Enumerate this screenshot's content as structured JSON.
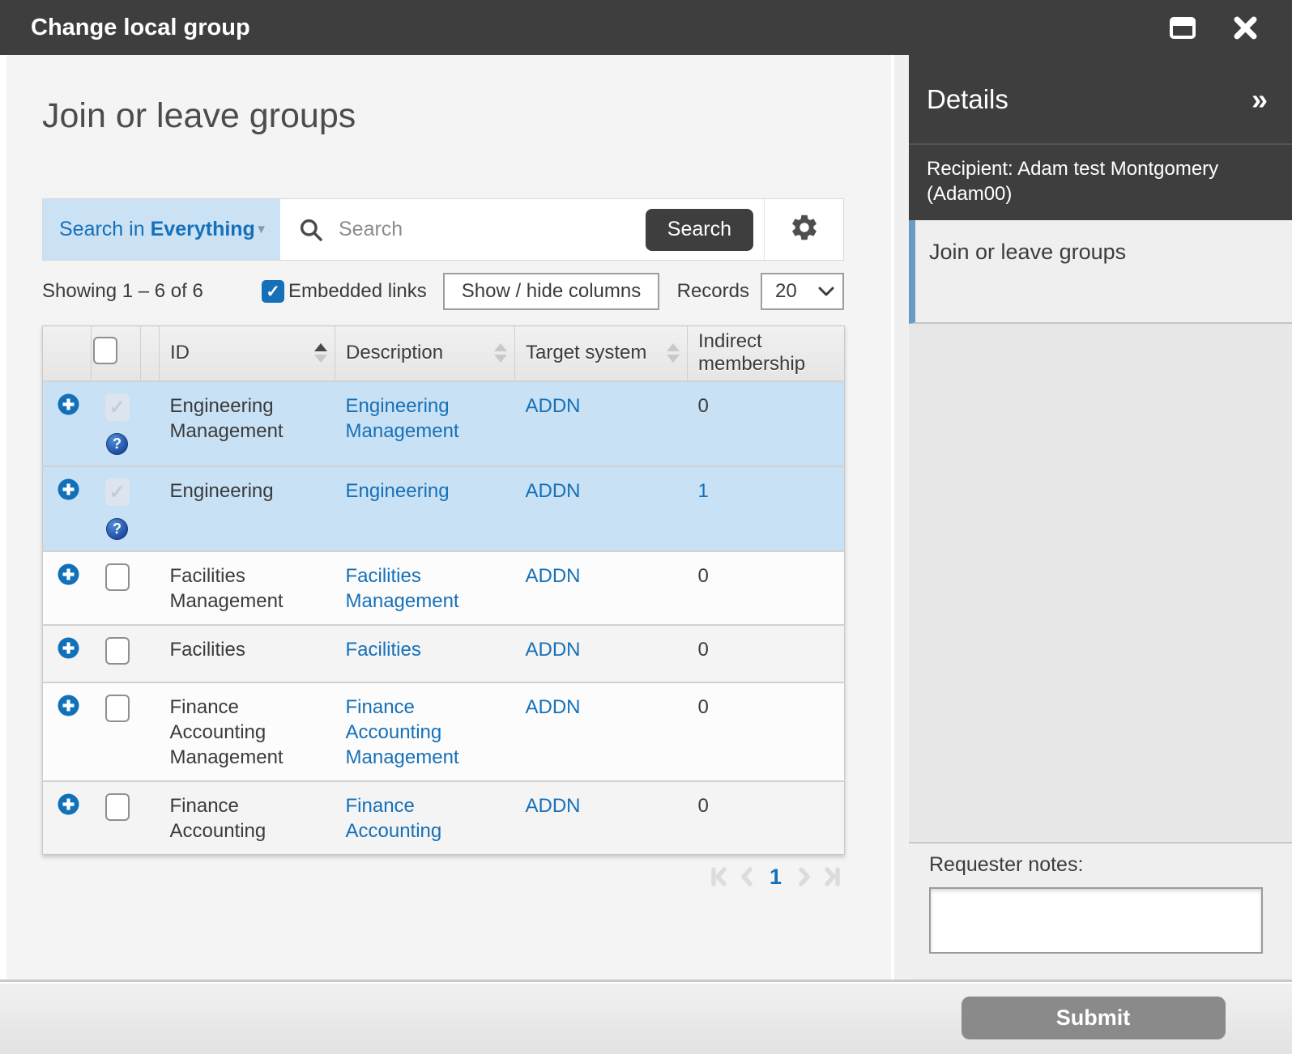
{
  "window": {
    "title": "Change local group"
  },
  "main": {
    "heading": "Join or leave groups",
    "search": {
      "scope_prefix": "Search in",
      "scope_value": "Everything",
      "placeholder": "Search",
      "button_label": "Search"
    },
    "controls": {
      "showing": "Showing 1 – 6 of 6",
      "embedded_links_label": "Embedded links",
      "embedded_links_checked": true,
      "show_hide_columns_label": "Show / hide columns",
      "records_label": "Records",
      "records_value": "20"
    },
    "table": {
      "headers": {
        "id": "ID",
        "description": "Description",
        "target_system": "Target system",
        "indirect_membership": "Indirect membership"
      },
      "sorted_column": "id",
      "sort_direction": "asc",
      "rows": [
        {
          "id": "Engineering Management",
          "description": "Engineering Management",
          "target_system": "ADDN",
          "indirect": "0",
          "selected": true,
          "checked": true,
          "checkbox_disabled": true,
          "has_help_icon": true,
          "indirect_is_link": false
        },
        {
          "id": "Engineering",
          "description": "Engineering",
          "target_system": "ADDN",
          "indirect": "1",
          "selected": true,
          "checked": true,
          "checkbox_disabled": true,
          "has_help_icon": true,
          "indirect_is_link": true
        },
        {
          "id": "Facilities Management",
          "description": "Facilities Management",
          "target_system": "ADDN",
          "indirect": "0",
          "selected": false,
          "checked": false,
          "checkbox_disabled": false,
          "has_help_icon": false,
          "indirect_is_link": false
        },
        {
          "id": "Facilities",
          "description": "Facilities",
          "target_system": "ADDN",
          "indirect": "0",
          "selected": false,
          "checked": false,
          "checkbox_disabled": false,
          "has_help_icon": false,
          "indirect_is_link": false
        },
        {
          "id": "Finance Accounting Management",
          "description": "Finance Accounting Management",
          "target_system": "ADDN",
          "indirect": "0",
          "selected": false,
          "checked": false,
          "checkbox_disabled": false,
          "has_help_icon": false,
          "indirect_is_link": false
        },
        {
          "id": "Finance Accounting",
          "description": "Finance Accounting",
          "target_system": "ADDN",
          "indirect": "0",
          "selected": false,
          "checked": false,
          "checkbox_disabled": false,
          "has_help_icon": false,
          "indirect_is_link": false
        }
      ]
    },
    "pagination": {
      "page": "1"
    }
  },
  "panel": {
    "title": "Details",
    "recipient": "Recipient: Adam test Montgomery (Adam00)",
    "selected_step": "Join or leave groups",
    "notes_label": "Requester notes:",
    "notes_value": ""
  },
  "footer": {
    "submit_label": "Submit"
  },
  "icons": {
    "help": "?",
    "collapse_panel": "»",
    "scope_caret": "▼",
    "checkbox_check": "✓"
  },
  "colors": {
    "titlebar": "#3e3e3e",
    "accent_blue": "#1670b8",
    "selected_row": "#c9e1f4",
    "scope_background": "#cbe2f5",
    "step_border_blue": "#689cc5",
    "submit_button": "#8a8a8a"
  }
}
